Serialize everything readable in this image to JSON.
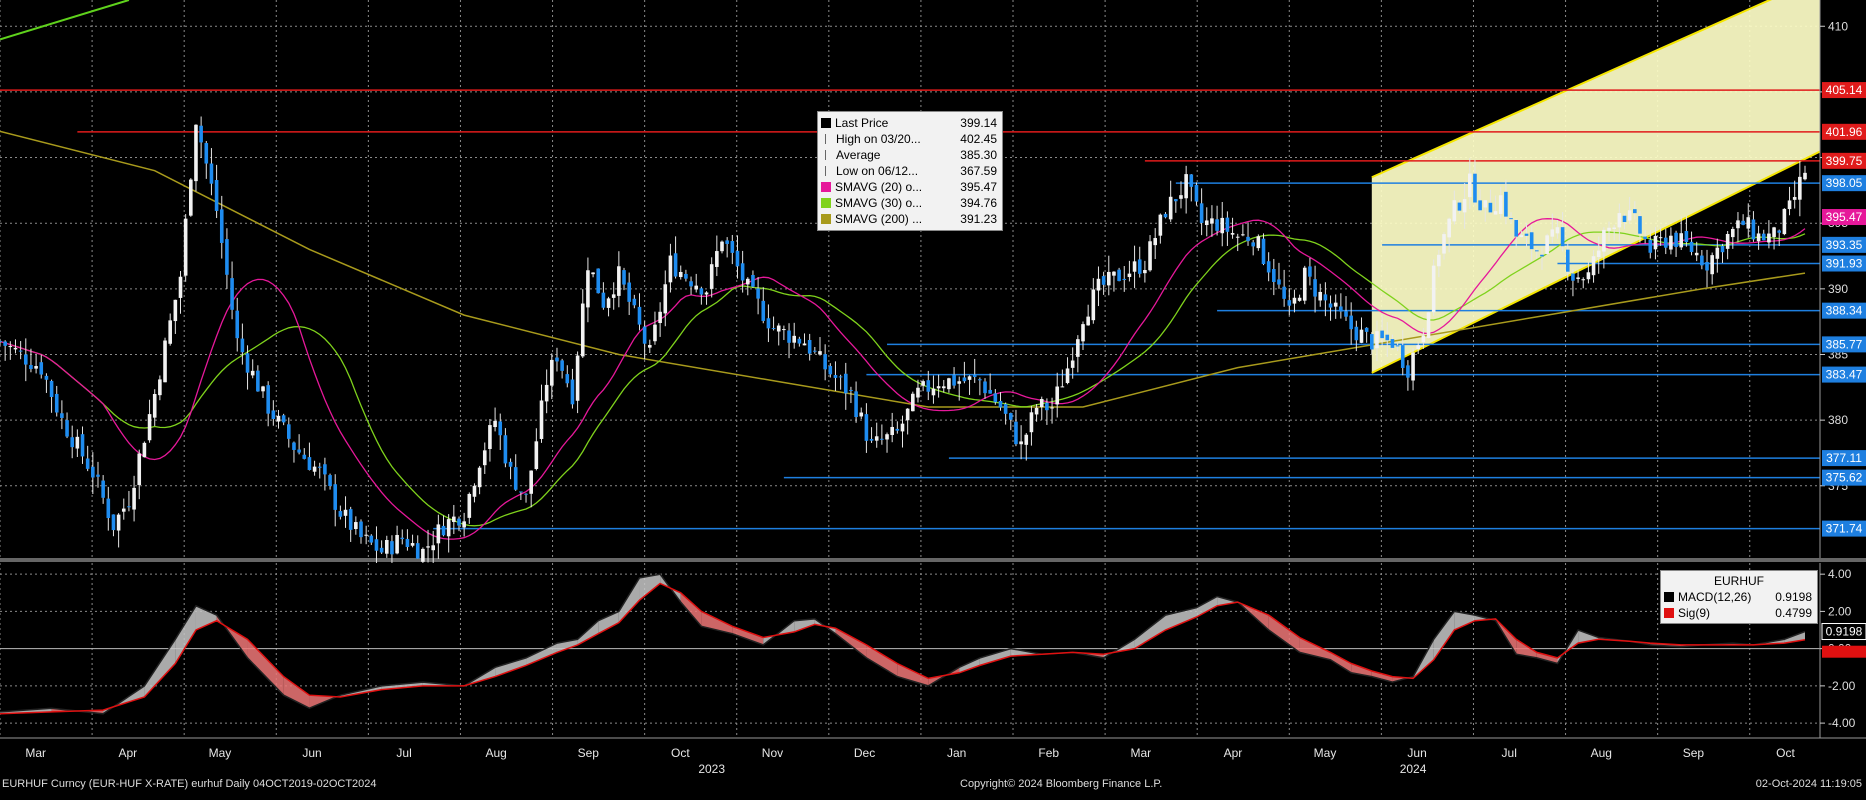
{
  "footer": {
    "left": "EURHUF Curncy (EUR-HUF X-RATE) eurhuf  Daily 04OCT2019-02OCT2024",
    "center": "Copyright© 2024 Bloomberg Finance L.P.",
    "right": "02-Oct-2024 11:19:05"
  },
  "legend_main": {
    "rows": [
      {
        "label": "Last Price",
        "value": "399.14",
        "color": "#000000"
      },
      {
        "label": "High on 03/20...",
        "value": "402.45",
        "color": ""
      },
      {
        "label": "Average",
        "value": "385.30",
        "color": ""
      },
      {
        "label": "Low on 06/12...",
        "value": "367.59",
        "color": ""
      },
      {
        "label": "SMAVG (20)  o...",
        "value": "395.47",
        "color": "#e6189a"
      },
      {
        "label": "SMAVG (30)  o...",
        "value": "394.76",
        "color": "#7fd21c"
      },
      {
        "label": "SMAVG (200) ...",
        "value": "391.23",
        "color": "#a89a1c"
      }
    ]
  },
  "legend_macd": {
    "title": "EURHUF",
    "rows": [
      {
        "label": "MACD(12,26)",
        "value": "0.9198",
        "color": "#000000"
      },
      {
        "label": "Sig(9)",
        "value": "0.4799",
        "color": "#e01010"
      }
    ]
  },
  "chart_data": [
    {
      "type": "candlestick",
      "title": "",
      "x_tick_labels": [
        "Mar",
        "Apr",
        "May",
        "Jun",
        "Jul",
        "Aug",
        "Sep",
        "Oct",
        "Nov",
        "Dec",
        "Jan",
        "Feb",
        "Mar",
        "Apr",
        "May",
        "Jun",
        "Jul",
        "Aug",
        "Sep",
        "Oct"
      ],
      "year_labels": [
        "2023",
        "2024"
      ],
      "ylim": [
        369.5,
        412
      ],
      "y_ticks": [
        375,
        380,
        385,
        390,
        395,
        400,
        405,
        410
      ],
      "price_path": [
        [
          0,
          386
        ],
        [
          8,
          384
        ],
        [
          12,
          380
        ],
        [
          18,
          376
        ],
        [
          22,
          372
        ],
        [
          25,
          374
        ],
        [
          30,
          382
        ],
        [
          35,
          391
        ],
        [
          38,
          403
        ],
        [
          42,
          396
        ],
        [
          46,
          386
        ],
        [
          52,
          381
        ],
        [
          57,
          378
        ],
        [
          62,
          376
        ],
        [
          66,
          373
        ],
        [
          70,
          371
        ],
        [
          74,
          370
        ],
        [
          78,
          371
        ],
        [
          82,
          370
        ],
        [
          86,
          372
        ],
        [
          90,
          373
        ],
        [
          93,
          377
        ],
        [
          96,
          380
        ],
        [
          99,
          376
        ],
        [
          102,
          374
        ],
        [
          106,
          383
        ],
        [
          108,
          385
        ],
        [
          111,
          382
        ],
        [
          114,
          392
        ],
        [
          117,
          389
        ],
        [
          120,
          391
        ],
        [
          123,
          388
        ],
        [
          126,
          385
        ],
        [
          130,
          392
        ],
        [
          133,
          391
        ],
        [
          137,
          390
        ],
        [
          140,
          394
        ],
        [
          145,
          390
        ],
        [
          150,
          387
        ],
        [
          156,
          386
        ],
        [
          160,
          384
        ],
        [
          165,
          382
        ],
        [
          169,
          378
        ],
        [
          174,
          379
        ],
        [
          178,
          382
        ],
        [
          182,
          383
        ],
        [
          186,
          383
        ],
        [
          190,
          383
        ],
        [
          194,
          381
        ],
        [
          198,
          378
        ],
        [
          201,
          381
        ],
        [
          204,
          381
        ],
        [
          207,
          384
        ],
        [
          210,
          388
        ],
        [
          213,
          390
        ],
        [
          217,
          391
        ],
        [
          222,
          392
        ],
        [
          226,
          396
        ],
        [
          230,
          398
        ],
        [
          233,
          395
        ],
        [
          236,
          395
        ],
        [
          240,
          394
        ],
        [
          243,
          394
        ],
        [
          247,
          391
        ],
        [
          250,
          388
        ],
        [
          253,
          391
        ],
        [
          257,
          389
        ],
        [
          262,
          387
        ],
        [
          266,
          386
        ],
        [
          270,
          386
        ],
        [
          273,
          384
        ],
        [
          276,
          387
        ],
        [
          279,
          393
        ],
        [
          282,
          396
        ],
        [
          285,
          398
        ],
        [
          288,
          396
        ],
        [
          291,
          397
        ],
        [
          294,
          394
        ],
        [
          298,
          393
        ],
        [
          302,
          394
        ],
        [
          305,
          391
        ],
        [
          308,
          391
        ],
        [
          311,
          394
        ],
        [
          314,
          396
        ],
        [
          317,
          395
        ],
        [
          320,
          393
        ],
        [
          324,
          394
        ],
        [
          328,
          393
        ],
        [
          331,
          392
        ],
        [
          335,
          394
        ],
        [
          338,
          395
        ],
        [
          341,
          394
        ],
        [
          344,
          394
        ],
        [
          347,
          396
        ],
        [
          350,
          399
        ]
      ],
      "sma200_path": [
        [
          0,
          402
        ],
        [
          30,
          399
        ],
        [
          60,
          393
        ],
        [
          90,
          388
        ],
        [
          120,
          385
        ],
        [
          150,
          383
        ],
        [
          180,
          381
        ],
        [
          210,
          381
        ],
        [
          240,
          384
        ],
        [
          270,
          386
        ],
        [
          300,
          388
        ],
        [
          330,
          390
        ],
        [
          350,
          391.2
        ]
      ],
      "horizontal_levels": [
        {
          "value": 405.14,
          "label": "405.14",
          "color": "#e01b1b"
        },
        {
          "value": 401.96,
          "label": "401.96",
          "color": "#e01b1b"
        },
        {
          "value": 399.75,
          "label": "399.75",
          "color": "#e01b1b"
        },
        {
          "value": 398.05,
          "label": "398.05",
          "color": "#1e7fe0"
        },
        {
          "value": 393.35,
          "label": "393.35",
          "color": "#1e7fe0"
        },
        {
          "value": 391.93,
          "label": "391.93",
          "color": "#1e7fe0"
        },
        {
          "value": 388.34,
          "label": "388.34",
          "color": "#1e7fe0"
        },
        {
          "value": 385.77,
          "label": "385.77",
          "color": "#1e7fe0"
        },
        {
          "value": 383.47,
          "label": "383.47",
          "color": "#1e7fe0"
        },
        {
          "value": 377.11,
          "label": "377.11",
          "color": "#1e7fe0"
        },
        {
          "value": 375.62,
          "label": "375.62",
          "color": "#1e7fe0"
        },
        {
          "value": 371.74,
          "label": "371.74",
          "color": "#1e7fe0"
        }
      ],
      "value_tags": [
        {
          "value": 395.47,
          "label": "395.47",
          "color": "#e6189a"
        }
      ],
      "last_price": 399.14
    },
    {
      "type": "line",
      "title": "",
      "ylim": [
        -4.8,
        4.6
      ],
      "y_ticks": [
        -4,
        -2,
        0,
        2,
        4
      ],
      "y_tick_labels": [
        "-4.00",
        "-2.00",
        "0.00",
        "2.00",
        "4.00"
      ],
      "series": [
        {
          "name": "MACD(12,26)",
          "color": "#111111",
          "last_label": "0.9198",
          "values": [
            [
              0,
              -3.4
            ],
            [
              10,
              -3.2
            ],
            [
              20,
              -3.5
            ],
            [
              28,
              -2.0
            ],
            [
              34,
              0.5
            ],
            [
              38,
              2.3
            ],
            [
              42,
              1.8
            ],
            [
              48,
              -0.5
            ],
            [
              55,
              -2.5
            ],
            [
              60,
              -3.2
            ],
            [
              66,
              -2.5
            ],
            [
              74,
              -2.0
            ],
            [
              82,
              -1.8
            ],
            [
              90,
              -2.0
            ],
            [
              96,
              -1.0
            ],
            [
              102,
              -0.5
            ],
            [
              108,
              0.3
            ],
            [
              112,
              0.5
            ],
            [
              116,
              1.5
            ],
            [
              120,
              2.0
            ],
            [
              124,
              3.8
            ],
            [
              128,
              4.0
            ],
            [
              132,
              2.5
            ],
            [
              136,
              1.2
            ],
            [
              142,
              0.8
            ],
            [
              148,
              0.2
            ],
            [
              154,
              1.5
            ],
            [
              158,
              1.6
            ],
            [
              162,
              0.8
            ],
            [
              168,
              -0.5
            ],
            [
              174,
              -1.5
            ],
            [
              180,
              -2.0
            ],
            [
              186,
              -1.0
            ],
            [
              190,
              -0.5
            ],
            [
              196,
              0.0
            ],
            [
              202,
              -0.3
            ],
            [
              208,
              -0.2
            ],
            [
              214,
              -0.5
            ],
            [
              220,
              0.5
            ],
            [
              226,
              1.8
            ],
            [
              232,
              2.2
            ],
            [
              236,
              2.8
            ],
            [
              240,
              2.5
            ],
            [
              246,
              1.0
            ],
            [
              252,
              -0.2
            ],
            [
              258,
              -0.6
            ],
            [
              262,
              -1.3
            ],
            [
              266,
              -1.5
            ],
            [
              270,
              -1.8
            ],
            [
              274,
              -1.5
            ],
            [
              278,
              0.5
            ],
            [
              282,
              2.0
            ],
            [
              286,
              1.8
            ],
            [
              290,
              1.5
            ],
            [
              294,
              -0.3
            ],
            [
              298,
              -0.5
            ],
            [
              302,
              -0.8
            ],
            [
              306,
              1.0
            ],
            [
              310,
              0.6
            ],
            [
              316,
              0.4
            ],
            [
              320,
              0.2
            ],
            [
              326,
              0.1
            ],
            [
              330,
              0.2
            ],
            [
              336,
              0.3
            ],
            [
              340,
              0.2
            ],
            [
              346,
              0.5
            ],
            [
              350,
              0.9198
            ]
          ]
        },
        {
          "name": "Sig(9)",
          "color": "#e01010",
          "last_label": "0.4799",
          "values": [
            [
              0,
              -3.5
            ],
            [
              10,
              -3.4
            ],
            [
              20,
              -3.3
            ],
            [
              28,
              -2.6
            ],
            [
              34,
              -0.8
            ],
            [
              38,
              1.0
            ],
            [
              42,
              1.5
            ],
            [
              48,
              0.5
            ],
            [
              55,
              -1.5
            ],
            [
              60,
              -2.5
            ],
            [
              66,
              -2.6
            ],
            [
              74,
              -2.2
            ],
            [
              82,
              -2.0
            ],
            [
              90,
              -2.0
            ],
            [
              96,
              -1.5
            ],
            [
              102,
              -0.9
            ],
            [
              108,
              -0.2
            ],
            [
              112,
              0.2
            ],
            [
              116,
              0.8
            ],
            [
              120,
              1.4
            ],
            [
              124,
              2.6
            ],
            [
              128,
              3.5
            ],
            [
              132,
              3.0
            ],
            [
              136,
              2.0
            ],
            [
              142,
              1.2
            ],
            [
              148,
              0.6
            ],
            [
              154,
              0.9
            ],
            [
              158,
              1.3
            ],
            [
              162,
              1.1
            ],
            [
              168,
              0.2
            ],
            [
              174,
              -0.8
            ],
            [
              180,
              -1.6
            ],
            [
              186,
              -1.3
            ],
            [
              190,
              -0.9
            ],
            [
              196,
              -0.4
            ],
            [
              202,
              -0.3
            ],
            [
              208,
              -0.2
            ],
            [
              214,
              -0.3
            ],
            [
              220,
              0.0
            ],
            [
              226,
              1.0
            ],
            [
              232,
              1.7
            ],
            [
              236,
              2.3
            ],
            [
              240,
              2.5
            ],
            [
              246,
              1.8
            ],
            [
              252,
              0.6
            ],
            [
              258,
              -0.2
            ],
            [
              262,
              -0.8
            ],
            [
              266,
              -1.2
            ],
            [
              270,
              -1.5
            ],
            [
              274,
              -1.6
            ],
            [
              278,
              -0.6
            ],
            [
              282,
              1.0
            ],
            [
              286,
              1.5
            ],
            [
              290,
              1.6
            ],
            [
              294,
              0.5
            ],
            [
              298,
              -0.2
            ],
            [
              302,
              -0.5
            ],
            [
              306,
              0.3
            ],
            [
              310,
              0.5
            ],
            [
              316,
              0.4
            ],
            [
              320,
              0.3
            ],
            [
              326,
              0.2
            ],
            [
              330,
              0.2
            ],
            [
              336,
              0.2
            ],
            [
              340,
              0.2
            ],
            [
              346,
              0.3
            ],
            [
              350,
              0.4799
            ]
          ]
        }
      ]
    }
  ]
}
